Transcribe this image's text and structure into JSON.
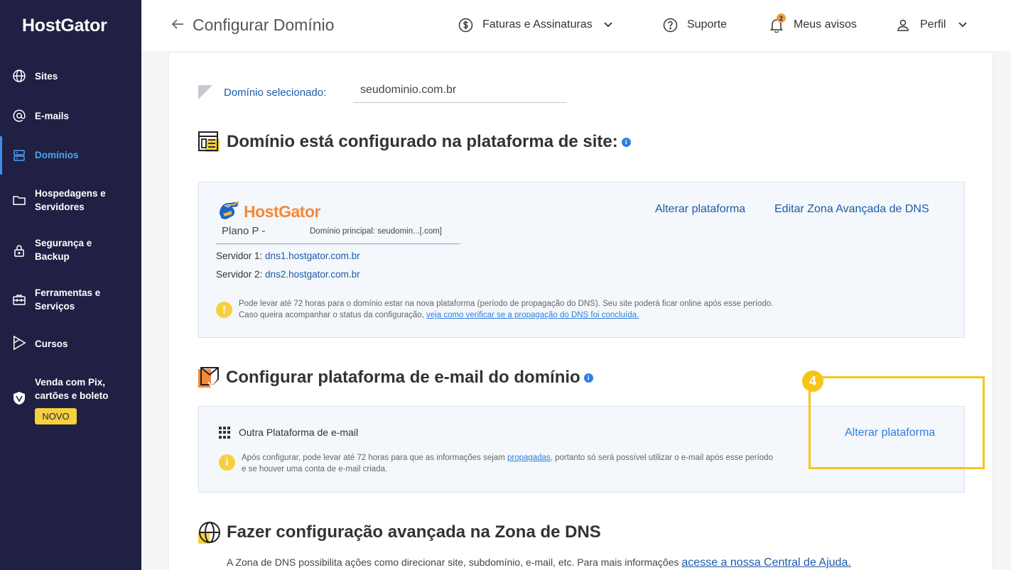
{
  "brand": {
    "logo": "HostGator",
    "accent": "#1f2044",
    "link": "#1e5aa8",
    "orange": "#f3893a",
    "yellow": "#f5c518"
  },
  "sidebar": {
    "items": [
      {
        "label": "Sites",
        "icon": "globe-icon"
      },
      {
        "label": "E-mails",
        "icon": "at-icon"
      },
      {
        "label": "Domínios",
        "icon": "server-icon",
        "active": true
      },
      {
        "label": "Hospedagens e Servidores",
        "line1": "Hospedagens e",
        "line2": "Servidores",
        "icon": "folder-icon"
      },
      {
        "label": "Segurança e Backup",
        "line1": "Segurança e",
        "line2": "Backup",
        "icon": "lock-icon"
      },
      {
        "label": "Ferramentas e Serviços",
        "line1": "Ferramentas e",
        "line2": "Serviços",
        "icon": "toolbox-icon"
      },
      {
        "label": "Cursos",
        "icon": "play-icon"
      },
      {
        "label": "Venda com Pix, cartões e boleto",
        "line1": "Venda com Pix,",
        "line2": "cartões e boleto",
        "icon": "shield-icon",
        "badge": "NOVO"
      }
    ]
  },
  "header": {
    "title": "Configurar Domínio",
    "back_icon": "arrow-left-icon",
    "faturas": "Faturas e Assinaturas",
    "suporte": "Suporte",
    "avisos": "Meus avisos",
    "avisos_count": "2",
    "perfil": "Perfil"
  },
  "domain": {
    "label": "Domínio selecionado:",
    "value": "seudominio.com.br"
  },
  "site_platform": {
    "title": "Domínio está configurado na plataforma de site:",
    "provider": "HostGator",
    "plan": "Plano P -",
    "main_domain": "Domínio principal: seudomin...[.com]",
    "server1_label": "Servidor 1:",
    "server1": "dns1.hostgator.com.br",
    "server2_label": "Servidor 2:",
    "server2": "dns2.hostgator.com.br",
    "change_link": "Alterar plataforma",
    "dns_link": "Editar Zona Avançada de DNS",
    "note_line1": "Pode levar até 72 horas para o domínio estar na nova plataforma (período de propagação do DNS). Seu site poderá ficar online após esse período.",
    "note_line2_prefix": "Caso queira acompanhar o status da configuração,",
    "note_line2_link": "veja como verificar se a propagação do DNS foi concluída."
  },
  "email_platform": {
    "title": "Configurar plataforma de e-mail do domínio",
    "platform": "Outra Plataforma de e-mail",
    "change_link": "Alterar plataforma",
    "note_prefix": "Após configurar, pode levar até 72 horas para que as informações sejam",
    "note_link": "propagadas",
    "note_suffix": ", portanto só será possível utilizar o e-mail após esse período",
    "note_line2": "e se houver uma conta de e-mail criada.",
    "step": "4"
  },
  "dns_zone": {
    "title": "Fazer configuração avançada na Zona de DNS",
    "desc_prefix": "A Zona de DNS possibilita ações como direcionar site, subdomínio, e-mail, etc. Para mais informações",
    "desc_link": "acesse a nossa Central de Ajuda."
  }
}
